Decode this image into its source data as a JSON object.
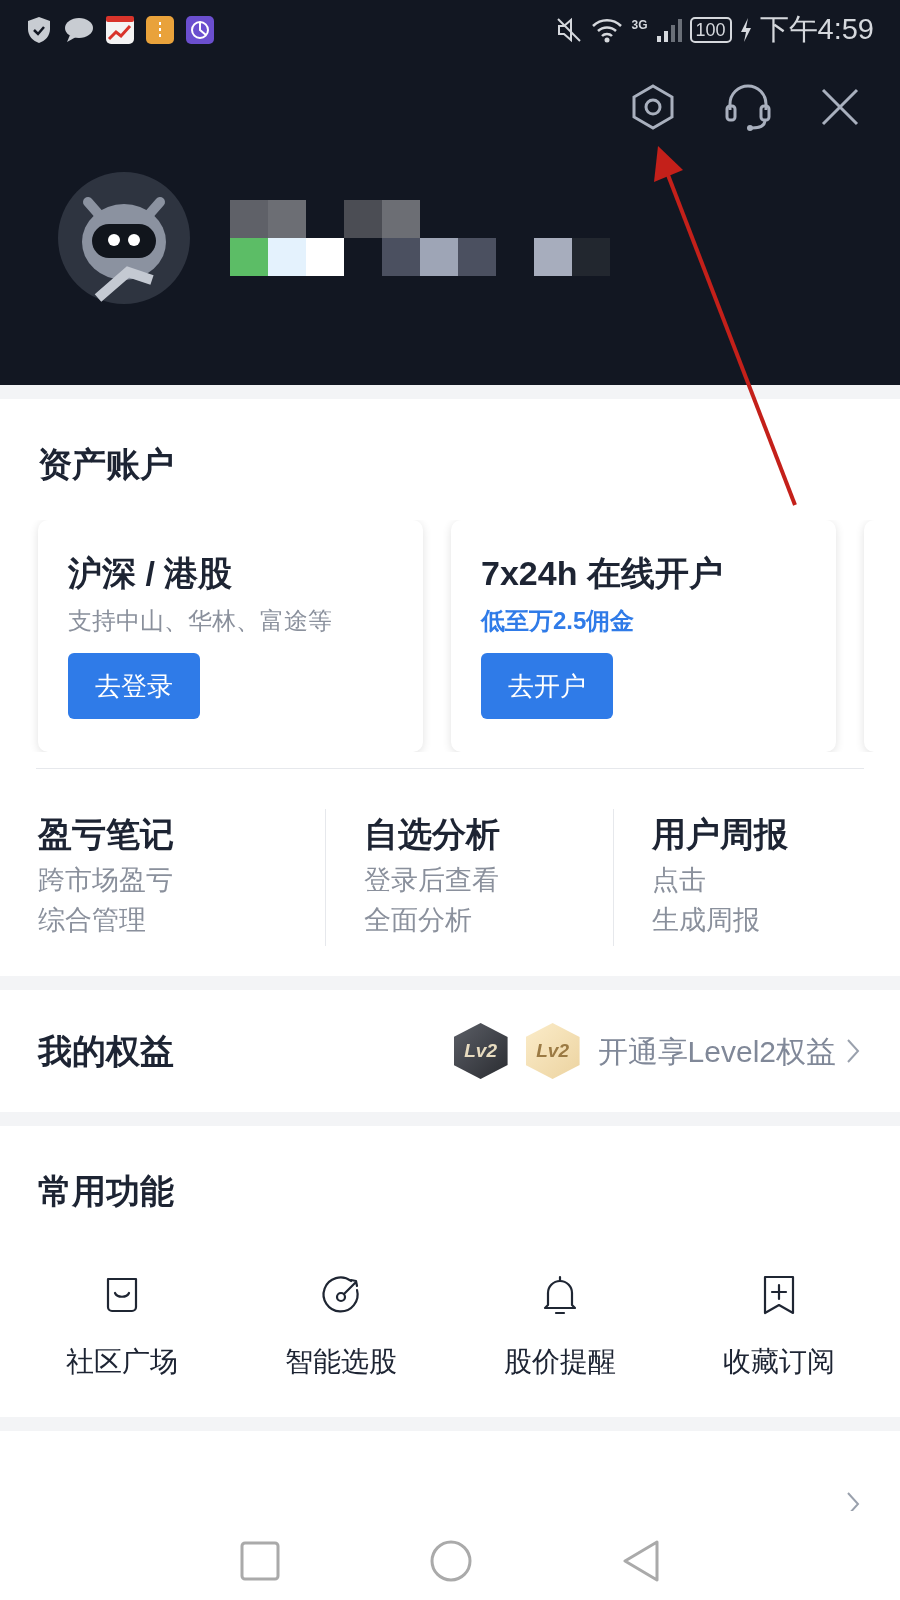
{
  "status_bar": {
    "network": "3G",
    "battery": "100",
    "time": "下午4:59"
  },
  "assets": {
    "title": "资产账户",
    "cards": [
      {
        "title": "沪深 / 港股",
        "subtitle": "支持中山、华林、富途等",
        "highlight": false,
        "button": "去登录"
      },
      {
        "title": "7x24h 在线开户",
        "subtitle": "低至万2.5佣金",
        "highlight": true,
        "button": "去开户"
      }
    ]
  },
  "notes": [
    {
      "title": "盈亏笔记",
      "lines": [
        "跨市场盈亏",
        "综合管理"
      ]
    },
    {
      "title": "自选分析",
      "lines": [
        "登录后查看",
        "全面分析"
      ]
    },
    {
      "title": "用户周报",
      "lines": [
        "点击",
        "生成周报"
      ]
    }
  ],
  "rights": {
    "title": "我的权益",
    "badges": [
      {
        "text": "Lv2",
        "kind": "dark"
      },
      {
        "text": "Lv2",
        "kind": "gold"
      }
    ],
    "link": "开通享Level2权益"
  },
  "functions": {
    "title": "常用功能",
    "items": [
      {
        "label": "社区广场",
        "kind": "community"
      },
      {
        "label": "智能选股",
        "kind": "picker"
      },
      {
        "label": "股价提醒",
        "kind": "alert"
      },
      {
        "label": "收藏订阅",
        "kind": "subscribe"
      }
    ]
  }
}
